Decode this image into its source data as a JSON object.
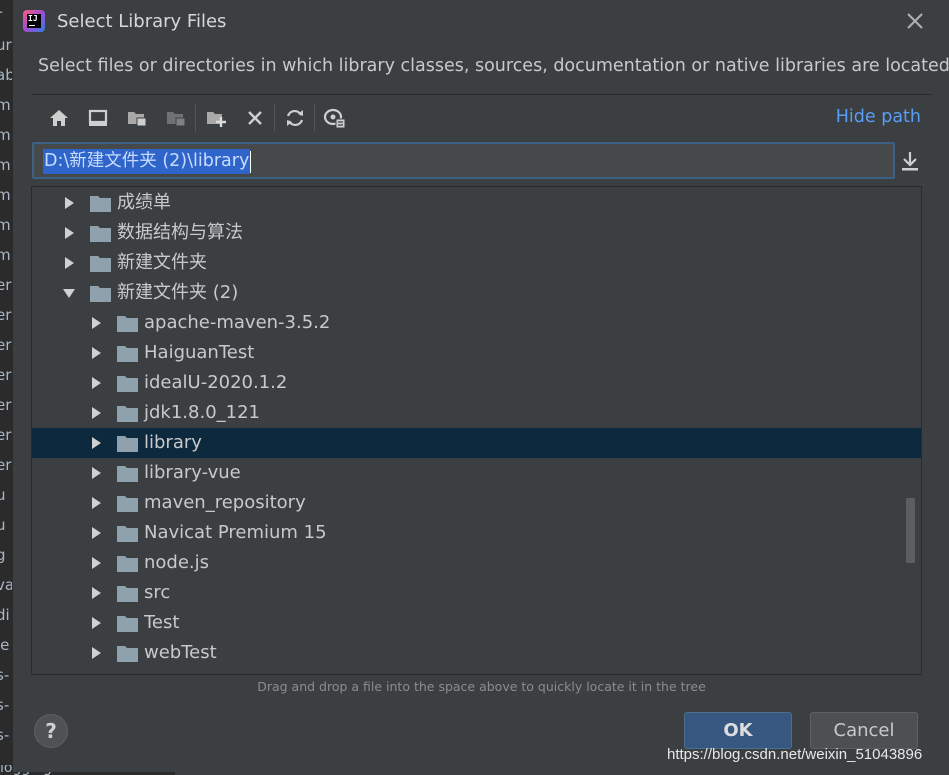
{
  "background": {
    "left_chars": [
      "r",
      "ur",
      "ab",
      "m",
      "m",
      "m",
      "m",
      "m",
      "m",
      "er",
      "er",
      "er",
      "er",
      "er",
      "er",
      "er",
      "u",
      "u",
      "g",
      "va",
      "di",
      "ie",
      "s-",
      "s-",
      "s-"
    ],
    "bottom_text": "logging:commons"
  },
  "dialog": {
    "title": "Select Library Files",
    "description": "Select files or directories in which library classes, sources, documentation or native libraries are located",
    "hide_path": "Hide path",
    "path_value": "D:\\新建文件夹 (2)\\library",
    "hint": "Drag and drop a file into the space above to quickly locate it in the tree",
    "ok_label": "OK",
    "cancel_label": "Cancel",
    "help_label": "?"
  },
  "toolbar": {
    "icons": [
      "home-icon",
      "desktop-icon",
      "project-folder-icon",
      "module-folder-icon",
      "new-folder-icon",
      "delete-icon",
      "refresh-icon",
      "show-hidden-icon"
    ]
  },
  "tree": {
    "items": [
      {
        "label": "成绩单",
        "level": 0,
        "expanded": false,
        "selected": false
      },
      {
        "label": "数据结构与算法",
        "level": 0,
        "expanded": false,
        "selected": false
      },
      {
        "label": "新建文件夹",
        "level": 0,
        "expanded": false,
        "selected": false
      },
      {
        "label": "新建文件夹 (2)",
        "level": 0,
        "expanded": true,
        "selected": false
      },
      {
        "label": "apache-maven-3.5.2",
        "level": 1,
        "expanded": false,
        "selected": false
      },
      {
        "label": "HaiguanTest",
        "level": 1,
        "expanded": false,
        "selected": false
      },
      {
        "label": "idealU-2020.1.2",
        "level": 1,
        "expanded": false,
        "selected": false
      },
      {
        "label": "jdk1.8.0_121",
        "level": 1,
        "expanded": false,
        "selected": false
      },
      {
        "label": "library",
        "level": 1,
        "expanded": false,
        "selected": true
      },
      {
        "label": "library-vue",
        "level": 1,
        "expanded": false,
        "selected": false
      },
      {
        "label": "maven_repository",
        "level": 1,
        "expanded": false,
        "selected": false
      },
      {
        "label": "Navicat Premium 15",
        "level": 1,
        "expanded": false,
        "selected": false
      },
      {
        "label": "node.js",
        "level": 1,
        "expanded": false,
        "selected": false
      },
      {
        "label": "src",
        "level": 1,
        "expanded": false,
        "selected": false
      },
      {
        "label": "Test",
        "level": 1,
        "expanded": false,
        "selected": false
      },
      {
        "label": "webTest",
        "level": 1,
        "expanded": false,
        "selected": false
      }
    ]
  },
  "watermark": "https://blog.csdn.net/weixin_51043896",
  "colors": {
    "background": "#3c3f41",
    "selection": "#0d293e",
    "accent": "#589df6",
    "ok_button": "#365880",
    "folder": "#8fa1ad"
  }
}
